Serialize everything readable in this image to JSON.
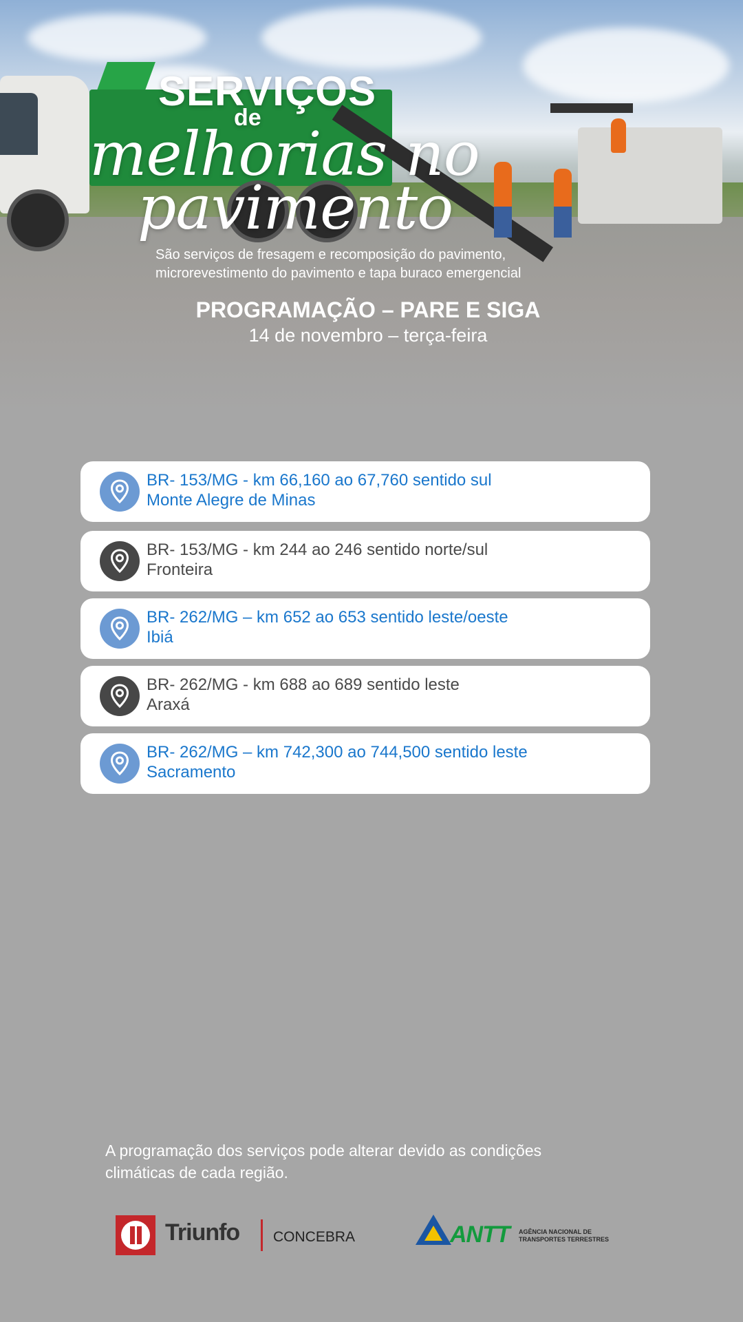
{
  "header": {
    "title_line1": "SERVIÇOS",
    "title_line2": "de",
    "title_line3": "melhorias no",
    "title_line4": "pavimento",
    "subtitle_line1": "São serviços de fresagem e recomposição do pavimento,",
    "subtitle_line2": "microrevestimento do pavimento e tapa buraco emergencial"
  },
  "schedule": {
    "title": "PROGRAMAÇÃO – PARE E SIGA",
    "date": "14 de novembro – terça-feira",
    "items": [
      {
        "road": "BR- 153/MG - km 66,160 ao 67,760 sentido sul",
        "city": "Monte Alegre de Minas",
        "icon": "location-pin-icon",
        "style": "blue"
      },
      {
        "road": "BR- 153/MG - km 244 ao 246 sentido norte/sul",
        "city": "Fronteira",
        "icon": "location-pin-icon",
        "style": "dark"
      },
      {
        "road": "BR- 262/MG – km 652 ao 653 sentido leste/oeste",
        "city": "Ibiá",
        "icon": "location-pin-icon",
        "style": "blue"
      },
      {
        "road": "BR- 262/MG - km 688 ao 689 sentido leste",
        "city": "Araxá",
        "icon": "location-pin-icon",
        "style": "dark"
      },
      {
        "road": "BR- 262/MG – km 742,300 ao 744,500 sentido leste",
        "city": "Sacramento",
        "icon": "location-pin-icon",
        "style": "blue"
      }
    ]
  },
  "footer": {
    "note_line1": "A programação dos serviços pode alterar devido as condições",
    "note_line2": "climáticas de cada região.",
    "logo_triunfo": "Triunfo",
    "logo_concebra": "CONCEBRA",
    "logo_antt": "ANTT",
    "logo_antt_sub1": "AGÊNCIA NACIONAL DE",
    "logo_antt_sub2": "TRANSPORTES TERRESTRES"
  },
  "colors": {
    "background": "#a6a6a6",
    "accent_blue": "#1a77cc",
    "pin_blue": "#6c9ad3",
    "pin_dark": "#474747",
    "text_dark": "#4a4a4a"
  }
}
